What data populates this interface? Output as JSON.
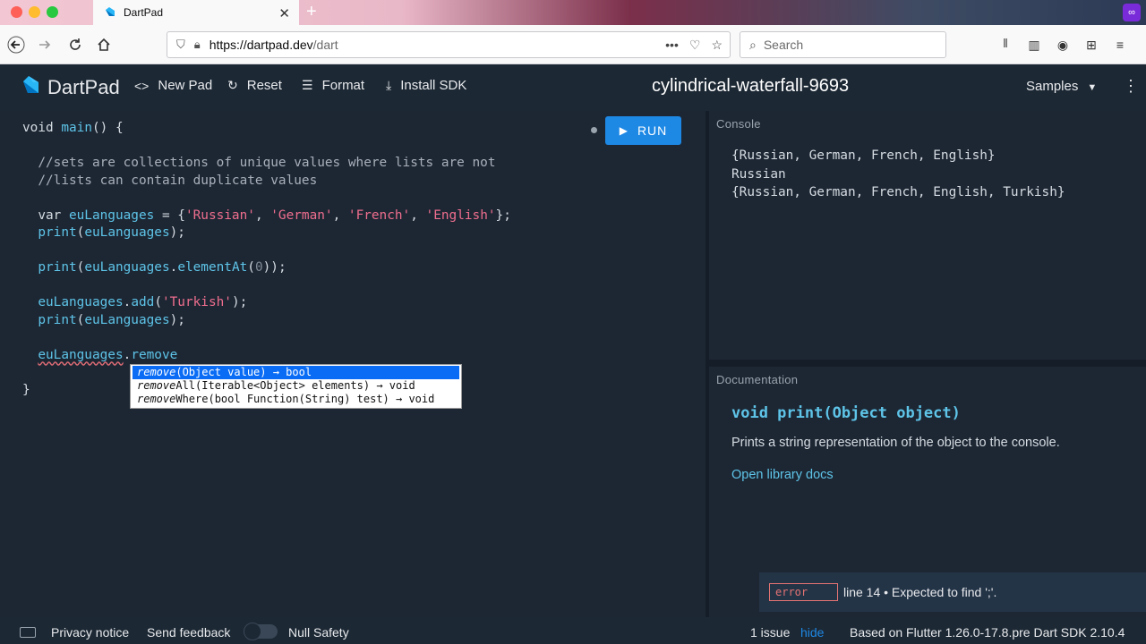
{
  "browser": {
    "tab_title": "DartPad",
    "url_host": "https://dartpad.dev",
    "url_path": "/dart",
    "search_placeholder": "Search"
  },
  "header": {
    "brand": "DartPad",
    "new_pad": "New Pad",
    "reset": "Reset",
    "format": "Format",
    "install_sdk": "Install SDK",
    "pad_name": "cylindrical-waterfall-9693",
    "samples": "Samples"
  },
  "editor": {
    "run_label": "RUN",
    "autocomplete": [
      {
        "prefix": "remove",
        "rest": "(Object value) → bool"
      },
      {
        "prefix": "remove",
        "rest": "All(Iterable<Object> elements) → void"
      },
      {
        "prefix": "remove",
        "rest": "Where(bool Function(String) test) → void"
      }
    ]
  },
  "console": {
    "label": "Console",
    "lines": [
      "{Russian, German, French, English}",
      "Russian",
      "{Russian, German, French, English, Turkish}"
    ]
  },
  "docs": {
    "label": "Documentation",
    "signature": "void print(Object object)",
    "description": "Prints a string representation of the object to the console.",
    "link": "Open library docs"
  },
  "error": {
    "badge": "error",
    "message": "line 14 • Expected to find ';'."
  },
  "footer": {
    "privacy": "Privacy notice",
    "feedback": "Send feedback",
    "null_safety": "Null Safety",
    "issues": "1 issue",
    "hide": "hide",
    "sdk_info": "Based on Flutter 1.26.0-17.8.pre Dart SDK 2.10.4"
  },
  "colors": {
    "background": "#1c2834",
    "accent": "#1e88e5",
    "identifier": "#5ec4e8",
    "string": "#ef6e8e",
    "error": "#e57373"
  }
}
